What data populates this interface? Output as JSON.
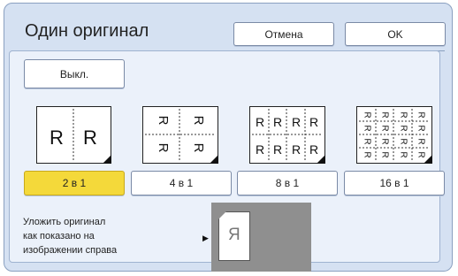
{
  "dialog": {
    "title": "Один оригинал",
    "cancel_label": "Отмена",
    "ok_label": "OK",
    "off_label": "Выкл."
  },
  "layouts": [
    {
      "label": "2 в 1",
      "selected": true,
      "glyph": "R"
    },
    {
      "label": "4 в 1",
      "selected": false,
      "glyph": "R"
    },
    {
      "label": "8 в 1",
      "selected": false,
      "glyph": "R"
    },
    {
      "label": "16 в 1",
      "selected": false,
      "glyph": "R"
    }
  ],
  "instruction": {
    "text": "Уложить оригинал\nкак показано на\nизображении справа",
    "arrow": "▶"
  },
  "preview": {
    "letter": "Я"
  },
  "colors": {
    "selected": "#f4d93a",
    "background": "#d5e1f2",
    "panel": "#ebf1fa"
  }
}
